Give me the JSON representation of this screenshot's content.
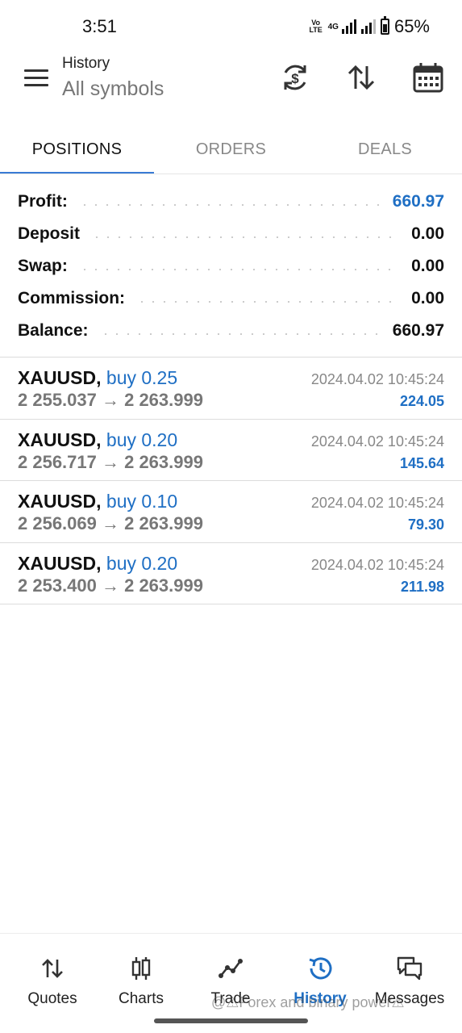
{
  "status": {
    "time": "3:51",
    "volte": "Vo LTE",
    "network": "4G",
    "battery": "65%",
    "battery_level": 0.65
  },
  "header": {
    "title": "History",
    "subtitle": "All symbols"
  },
  "tabs": [
    {
      "label": "POSITIONS",
      "active": true
    },
    {
      "label": "ORDERS",
      "active": false
    },
    {
      "label": "DEALS",
      "active": false
    }
  ],
  "summary": [
    {
      "label": "Profit:",
      "value": "660.97"
    },
    {
      "label": "Deposit",
      "value": "0.00"
    },
    {
      "label": "Swap:",
      "value": "0.00"
    },
    {
      "label": "Commission:",
      "value": "0.00"
    },
    {
      "label": "Balance:",
      "value": "660.97"
    }
  ],
  "deals": [
    {
      "symbol": "XAUUSD,",
      "side": "buy 0.25",
      "prices": "2 255.037 → 2 263.999",
      "time": "2024.04.02 10:45:24",
      "profit": "224.05"
    },
    {
      "symbol": "XAUUSD,",
      "side": "buy 0.20",
      "prices": "2 256.717 → 2 263.999",
      "time": "2024.04.02 10:45:24",
      "profit": "145.64"
    },
    {
      "symbol": "XAUUSD,",
      "side": "buy 0.10",
      "prices": "2 256.069 → 2 263.999",
      "time": "2024.04.02 10:45:24",
      "profit": "79.30"
    },
    {
      "symbol": "XAUUSD,",
      "side": "buy 0.20",
      "prices": "2 253.400 → 2 263.999",
      "time": "2024.04.02 10:45:24",
      "profit": "211.98"
    }
  ],
  "bottom_nav": [
    {
      "label": "Quotes",
      "icon": "quotes-icon"
    },
    {
      "label": "Charts",
      "icon": "charts-icon"
    },
    {
      "label": "Trade",
      "icon": "trade-icon"
    },
    {
      "label": "History",
      "icon": "history-icon",
      "active": true
    },
    {
      "label": "Messages",
      "icon": "messages-icon"
    }
  ],
  "watermark": "@⚠Forex and binary power⚠",
  "colors": {
    "accent": "#1f6fc4",
    "tab_indicator": "#3a7bd5"
  }
}
